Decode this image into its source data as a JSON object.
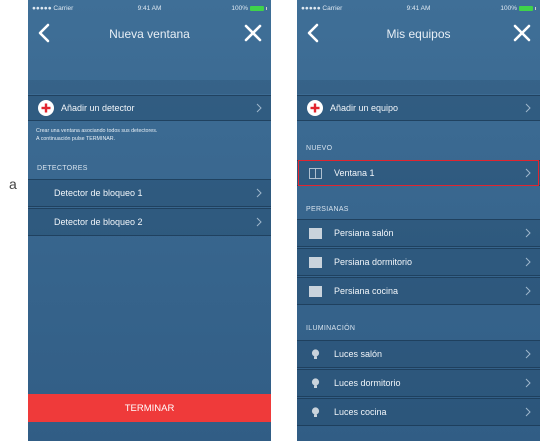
{
  "status": {
    "carrier": "●●●●● Carrier",
    "time": "9:41 AM",
    "battery": "100%"
  },
  "left_screen": {
    "title": "Nueva ventana",
    "add_detector_label": "Añadir un detector",
    "info_text_line1": "Crear una ventana asociando todos sus detectores.",
    "info_text_line2": "A continuación pulse TERMINAR.",
    "section_detectors": "DETECTORES",
    "detectors": [
      "Detector de bloqueo 1",
      "Detector de bloqueo 2"
    ],
    "terminate_label": "TERMINAR"
  },
  "right_screen": {
    "title": "Mis equipos",
    "add_equipment_label": "Añadir un equipo",
    "section_new": "NUEVO",
    "new_items": [
      "Ventana 1"
    ],
    "section_blinds": "PERSIANAS",
    "blinds": [
      "Persiana salón",
      "Persiana dormitorio",
      "Persiana cocina"
    ],
    "section_lighting": "ILUMINACIÓN",
    "lights": [
      "Luces salón",
      "Luces dormitorio",
      "Luces cocina"
    ]
  },
  "page_fragment": "a",
  "colors": {
    "background": "#3a6890",
    "accent_red": "#ef3a3a",
    "highlight_border": "#e2252f"
  }
}
